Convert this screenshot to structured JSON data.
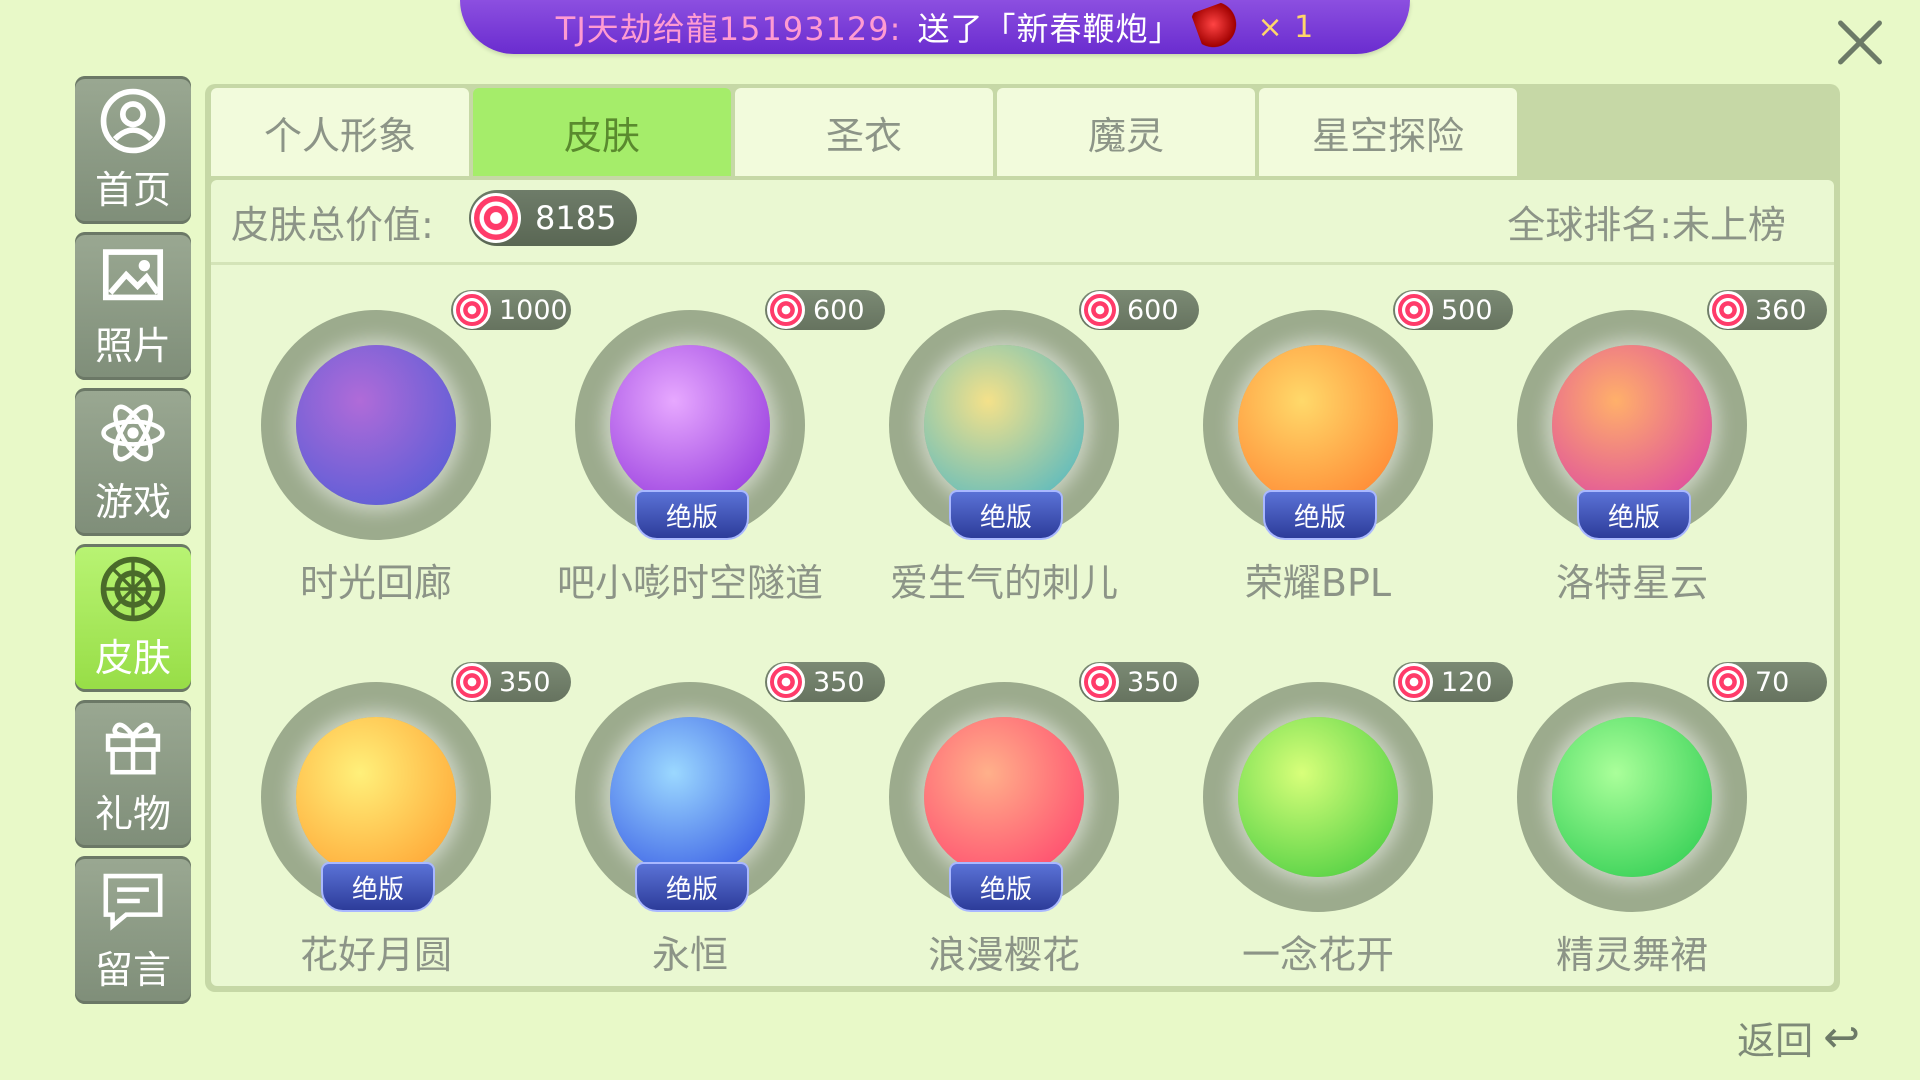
{
  "banner": {
    "sender": "TJ天劫给龍15193129:",
    "action": "送了「新春鞭炮」",
    "count": "× 1"
  },
  "sidebar": {
    "items": [
      {
        "label": "首页",
        "icon": "user-circle-icon",
        "active": false
      },
      {
        "label": "照片",
        "icon": "photo-icon",
        "active": false
      },
      {
        "label": "游戏",
        "icon": "atom-icon",
        "active": false
      },
      {
        "label": "皮肤",
        "icon": "skin-icon",
        "active": true
      },
      {
        "label": "礼物",
        "icon": "gift-icon",
        "active": false
      },
      {
        "label": "留言",
        "icon": "message-icon",
        "active": false
      }
    ]
  },
  "tabs": [
    {
      "label": "个人形象",
      "active": false
    },
    {
      "label": "皮肤",
      "active": true
    },
    {
      "label": "圣衣",
      "active": false
    },
    {
      "label": "魔灵",
      "active": false
    },
    {
      "label": "星空探险",
      "active": false
    }
  ],
  "summary": {
    "value_label": "皮肤总价值:",
    "total": "8185",
    "rank": "全球排名:未上榜"
  },
  "skins": [
    {
      "name": "时光回廊",
      "price": "1000",
      "badge": "",
      "color1": "#b06bd8",
      "color2": "#4a5bd6"
    },
    {
      "name": "吧小嘭时空隧道",
      "price": "600",
      "badge": "绝版",
      "color1": "#e7a8ff",
      "color2": "#8a2bd8"
    },
    {
      "name": "爱生气的刺儿",
      "price": "600",
      "badge": "绝版",
      "color1": "#f4e18a",
      "color2": "#3fb3c8"
    },
    {
      "name": "荣耀BPL",
      "price": "500",
      "badge": "绝版",
      "color1": "#ffd96a",
      "color2": "#ff7a2a"
    },
    {
      "name": "洛特星云",
      "price": "360",
      "badge": "绝版",
      "color1": "#ffb06a",
      "color2": "#d83aa8"
    },
    {
      "name": "花好月圆",
      "price": "350",
      "badge": "绝版",
      "color1": "#fff07a",
      "color2": "#ff9a2a"
    },
    {
      "name": "永恒",
      "price": "350",
      "badge": "绝版",
      "color1": "#9bd8ff",
      "color2": "#2a4ae0"
    },
    {
      "name": "浪漫樱花",
      "price": "350",
      "badge": "绝版",
      "color1": "#ffb08a",
      "color2": "#ff3a6a"
    },
    {
      "name": "一念花开",
      "price": "120",
      "badge": "",
      "color1": "#d8ff7a",
      "color2": "#3ac83a"
    },
    {
      "name": "精灵舞裙",
      "price": "70",
      "badge": "",
      "color1": "#aaff9a",
      "color2": "#22c84a"
    }
  ],
  "back_label": "返回"
}
